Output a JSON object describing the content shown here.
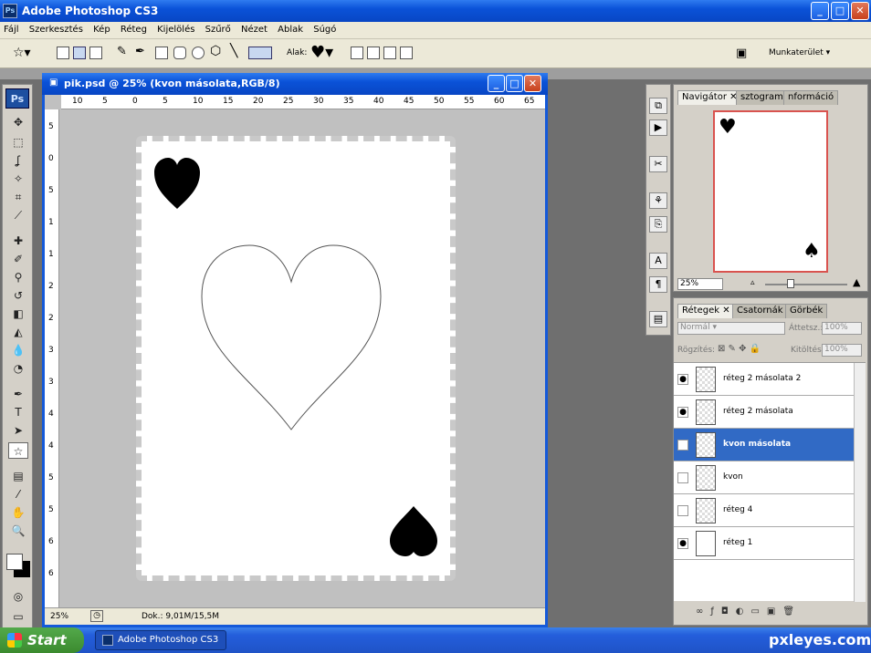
{
  "app": {
    "title": "Adobe Photoshop CS3",
    "ps_icon": "Ps"
  },
  "menu": [
    "Fájl",
    "Szerkesztés",
    "Kép",
    "Réteg",
    "Kijelölés",
    "Szűrő",
    "Nézet",
    "Ablak",
    "Súgó"
  ],
  "options": {
    "shape_label": "Alak:",
    "workspace_label": "Munkaterület"
  },
  "toolbox": {
    "logo": "Ps"
  },
  "document": {
    "title": "pik.psd @ 25% (kvon másolata,RGB/8)",
    "zoom": "25%",
    "doc_info": "Dok.: 9,01M/15,5M",
    "hruler": [
      "10",
      "5",
      "0",
      "5",
      "10",
      "15",
      "20",
      "25",
      "30",
      "35",
      "40",
      "45",
      "50",
      "55",
      "60",
      "65"
    ],
    "vruler": [
      "5",
      "0",
      "5",
      "1",
      "1",
      "2",
      "2",
      "3",
      "3",
      "4",
      "4",
      "5",
      "5",
      "6",
      "6"
    ]
  },
  "navigator": {
    "tabs": [
      "Navigátor",
      "sztogram",
      "nformáció"
    ],
    "zoom": "25%"
  },
  "layers_panel": {
    "tabs": [
      "Rétegek",
      "Csatornák",
      "Görbék"
    ],
    "blend_mode": "Normál",
    "opacity_label": "Áttetsz.:",
    "opacity": "100%",
    "lock_label": "Rögzítés:",
    "fill_label": "Kitöltés:",
    "fill": "100%",
    "layers": [
      {
        "name": "réteg 2 másolata 2",
        "visible": true,
        "active": false
      },
      {
        "name": "réteg 2 másolata",
        "visible": true,
        "active": false
      },
      {
        "name": "kvon másolata",
        "visible": false,
        "active": true
      },
      {
        "name": "kvon",
        "visible": false,
        "active": false
      },
      {
        "name": "réteg 4",
        "visible": false,
        "active": false
      },
      {
        "name": "réteg 1",
        "visible": true,
        "active": false
      }
    ]
  },
  "taskbar": {
    "start": "Start",
    "item": "Adobe Photoshop CS3"
  },
  "watermark": "pxleyes.com",
  "colors": {
    "titlebar": "#0a52d8",
    "active_layer": "#316ac5",
    "nav_frame": "#d9534f"
  }
}
